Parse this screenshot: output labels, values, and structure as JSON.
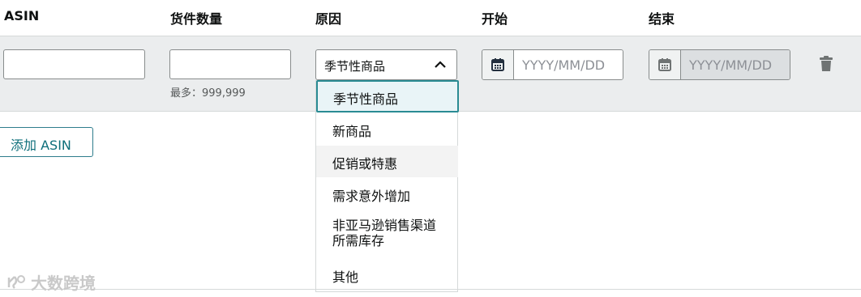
{
  "headers": {
    "asin": "ASIN",
    "quantity": "货件数量",
    "reason": "原因",
    "start": "开始",
    "end": "结束"
  },
  "row": {
    "asin_value": "",
    "quantity_value": "",
    "quantity_hint": "最多：999,999",
    "reason_selected": "季节性商品",
    "start_placeholder": "YYYY/MM/DD",
    "end_placeholder": "YYYY/MM/DD"
  },
  "add_button": "添加 ASIN",
  "dropdown_options": [
    "季节性商品",
    "新商品",
    "促销或特惠",
    "需求意外增加",
    "非亚马逊销售渠道所需库存",
    "其他"
  ],
  "watermark": "大数跨境",
  "colors": {
    "accent": "#2a8b93",
    "band": "#ebedee",
    "link": "#0d6e7a"
  },
  "icons": {
    "select_chevron": "chevron-up-icon",
    "calendar": "calendar-icon",
    "delete": "trash-icon"
  }
}
